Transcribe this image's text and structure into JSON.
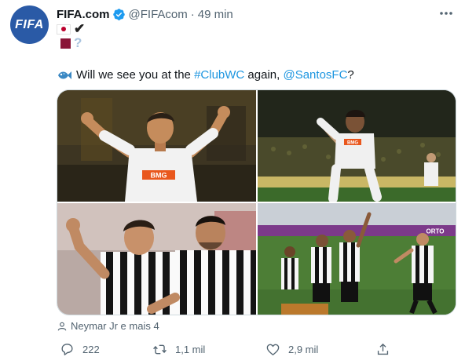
{
  "tweet": {
    "author_name": "FIFA.com",
    "avatar_text": "FIFA",
    "handle": "@FIFAcom",
    "separator": "·",
    "time": "49 min",
    "flag_lines": [
      {
        "flag": "japan-flag",
        "mark": "✔"
      },
      {
        "flag": "qatar-flag",
        "mark": "?"
      }
    ],
    "text_before": "Will we see you at the ",
    "hashtag": "#ClubWC",
    "text_middle": " again, ",
    "mention": "@SantosFC",
    "text_after": "?",
    "tagged_people": "Neymar Jr e mais 4",
    "photos": [
      {
        "caption": "BMG"
      },
      {
        "caption": "BMG"
      },
      {
        "caption": ""
      },
      {
        "caption": "ORTO"
      }
    ],
    "actions": {
      "replies": "222",
      "retweets": "1,1 mil",
      "likes": "2,9 mil"
    }
  },
  "colors": {
    "link": "#1b95e0",
    "secondary_text": "#536471",
    "verified": "#1d9bf0",
    "avatar_bg": "#2a5aa6"
  },
  "icons": [
    "fifa-logo-avatar",
    "verified-badge-icon",
    "more-icon",
    "japan-flag",
    "qatar-flag",
    "check-mark-icon",
    "question-mark-icon",
    "fish-emoji-icon",
    "tag-person-icon",
    "reply-icon",
    "retweet-icon",
    "like-icon",
    "share-icon"
  ]
}
